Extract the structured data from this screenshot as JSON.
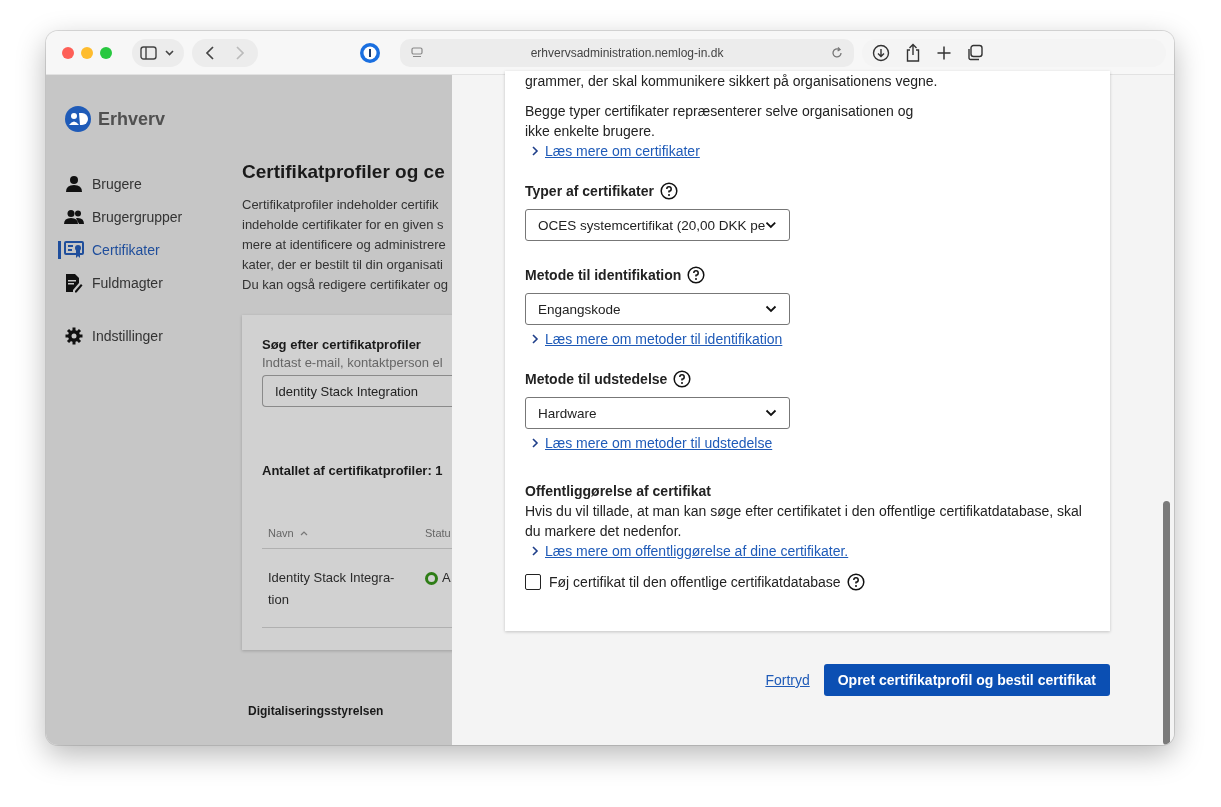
{
  "browser": {
    "url": "erhvervsadministration.nemlog-in.dk",
    "nav_buttons": [
      {
        "kind": "back",
        "disabled": false
      },
      {
        "kind": "forward",
        "disabled": true
      }
    ]
  },
  "sidebar": {
    "logo": "Erhverv",
    "items": [
      {
        "label": "Brugere",
        "kind": "user",
        "selected": false
      },
      {
        "label": "Brugergrupper",
        "kind": "group",
        "selected": false
      },
      {
        "label": "Certifikater",
        "kind": "certificate",
        "selected": true
      },
      {
        "label": "Fuldmagter",
        "kind": "document",
        "selected": false
      }
    ],
    "bottom_items": [
      {
        "label": "Indstillinger",
        "kind": "settings",
        "selected": false
      }
    ]
  },
  "page": {
    "title": "Certifikatprofiler og ce",
    "intro_lines": [
      "Certifikatprofiler indeholder certifik",
      "indeholde certifikater for en given s",
      "mere at identificere og administrere",
      "kater, der er bestilt til din organisati",
      "Du kan også redigere certifikater og"
    ],
    "search": {
      "label": "Søg efter certifikatprofiler",
      "hint": "Indtast e-mail, kontaktperson el",
      "value": "Identity Stack Integration"
    },
    "count": "Antallet af certifikatprofiler: 1",
    "table": {
      "columns": [
        "Navn",
        "Statu"
      ],
      "rows": [
        {
          "name": "Identity Stack Integra-tion",
          "status": "A",
          "color": "#2e7d16"
        }
      ]
    },
    "footer": "Digitaliseringsstyrelsen"
  },
  "panel": {
    "paragraphs": [
      "grammer, der skal kommunikere sikkert på organisationens vegne.",
      "Begge typer certifikater repræsenterer selve organisationen og ikke enkelte brugere."
    ],
    "intro_link": "Læs mere om certifikater",
    "fields": [
      {
        "label": "Typer af certifikater",
        "value": "OCES systemcertifikat (20,00 DKK pe"
      },
      {
        "label": "Metode til identifikation",
        "value": "Engangskode",
        "link": "Læs mere om metoder til identifikation"
      },
      {
        "label": "Metode til udstedelse",
        "value": "Hardware",
        "link": "Læs mere om metoder til udstedelse"
      }
    ],
    "publication": {
      "heading": "Offentliggørelse af certifikat",
      "text": "Hvis du vil tillade, at man kan søge efter certifikatet i den offentlige certifikatdatabase, skal du markere det nedenfor.",
      "link": "Læs mere om offentliggørelse af dine certifikater.",
      "checkbox": {
        "label": "Føj certifikat til den offentlige certifikatdatabase",
        "checked": false
      }
    },
    "cancel": "Fortryd",
    "submit": "Opret certifikatprofil og bestil certifikat"
  }
}
